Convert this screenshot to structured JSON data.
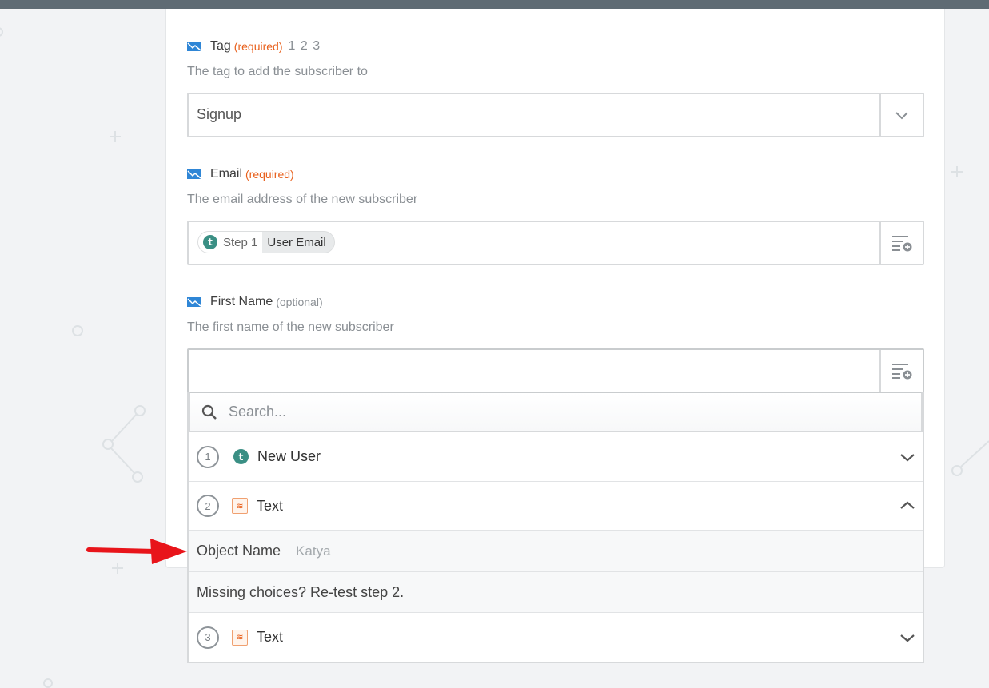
{
  "fields": {
    "tag": {
      "label": "Tag",
      "required_text": "(required)",
      "step_numbers": "1 2 3",
      "help": "The tag to add the subscriber to",
      "value": "Signup"
    },
    "email": {
      "label": "Email",
      "required_text": "(required)",
      "help": "The email address of the new subscriber",
      "pill": {
        "step": "Step 1",
        "value": "User Email",
        "app_letter": "t"
      }
    },
    "first_name": {
      "label": "First Name",
      "optional_text": "(optional)",
      "help": "The first name of the new subscriber",
      "value": ""
    }
  },
  "dropdown": {
    "search_placeholder": "Search...",
    "steps": [
      {
        "number": "1",
        "title": "New User",
        "icon": "t-app-icon",
        "expanded": false
      },
      {
        "number": "2",
        "title": "Text",
        "icon": "text-formatter-icon",
        "expanded": true
      },
      {
        "number": "3",
        "title": "Text",
        "icon": "text-formatter-icon",
        "expanded": false
      }
    ],
    "object_name": {
      "label": "Object Name",
      "value": "Katya"
    },
    "missing_text": "Missing choices? Re-test step 2."
  },
  "icons": {
    "app_t_letter": "t",
    "text_glyph": "≋"
  },
  "colors": {
    "required": "#e8601c",
    "app_teal": "#3a8f84",
    "arrow": "#e8141a",
    "top_bar": "#5f6b74"
  }
}
